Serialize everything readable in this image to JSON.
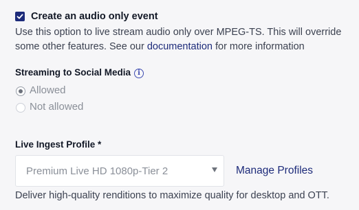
{
  "audio_only": {
    "checked": true,
    "label": "Create an audio only event",
    "help_before": "Use this option to live stream audio only over MPEG-TS. This will override some other features. See our ",
    "help_link": "documentation",
    "help_after": " for more information"
  },
  "social": {
    "title": "Streaming to Social Media",
    "info_icon": "info-icon",
    "options": [
      {
        "label": "Allowed",
        "selected": true
      },
      {
        "label": "Not allowed",
        "selected": false
      }
    ]
  },
  "ingest": {
    "title": "Live Ingest Profile *",
    "selected_value": "Premium Live HD 1080p-Tier 2",
    "manage_link": "Manage Profiles",
    "description": "Deliver high-quality renditions to maximize quality for desktop and OTT."
  },
  "colors": {
    "accent": "#1d2b7a",
    "background": "#f6f6f8",
    "muted_text": "#8a8f98"
  }
}
